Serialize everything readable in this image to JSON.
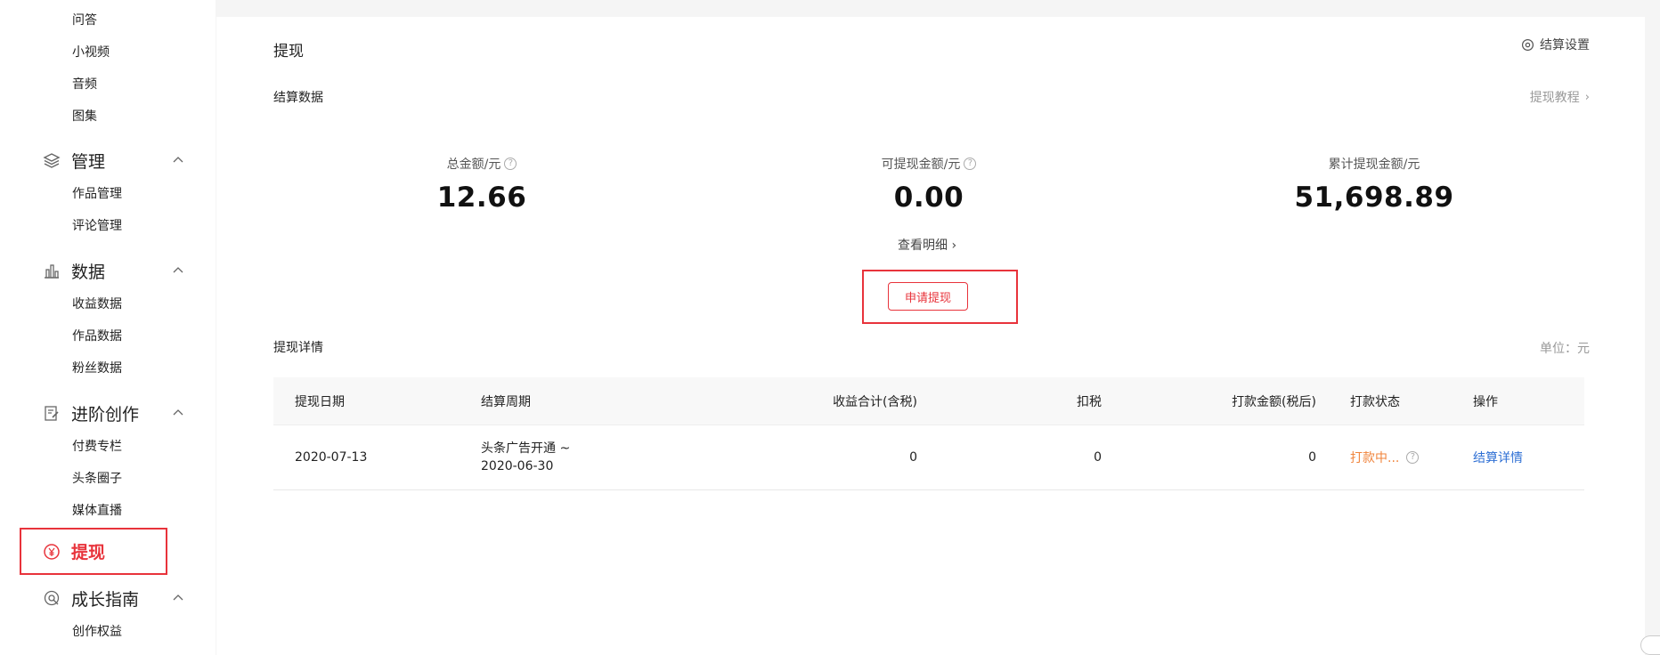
{
  "sidebar": {
    "top_items": [
      "问答",
      "小视频",
      "音频",
      "图集"
    ],
    "groups": [
      {
        "label": "管理",
        "icon": "layers-icon",
        "items": [
          "作品管理",
          "评论管理"
        ]
      },
      {
        "label": "数据",
        "icon": "bar-chart-icon",
        "items": [
          "收益数据",
          "作品数据",
          "粉丝数据"
        ]
      },
      {
        "label": "进阶创作",
        "icon": "edit-doc-icon",
        "items": [
          "付费专栏",
          "头条圈子",
          "媒体直播"
        ]
      }
    ],
    "active": {
      "label": "提现",
      "icon": "yen-circle-icon"
    },
    "growth": {
      "label": "成长指南",
      "icon": "growth-icon",
      "items": [
        "创作权益"
      ]
    }
  },
  "main": {
    "title": "提现",
    "settings_label": "结算设置",
    "section_settlement": "结算数据",
    "tutorial_label": "提现教程",
    "stats": [
      {
        "label": "总金额/元",
        "value": "12.66",
        "help": true
      },
      {
        "label": "可提现金额/元",
        "value": "0.00",
        "help": true
      },
      {
        "label": "累计提现金额/元",
        "value": "51,698.89",
        "help": false
      }
    ],
    "detail_link": "查看明细",
    "apply_button": "申请提现",
    "section_detail": "提现详情",
    "unit": "单位：元"
  },
  "table": {
    "headers": [
      "提现日期",
      "结算周期",
      "收益合计(含税)",
      "扣税",
      "打款金额(税后)",
      "打款状态",
      "操作"
    ],
    "rows": [
      {
        "date": "2020-07-13",
        "period_line1": "头条广告开通 ~",
        "period_line2": "2020-06-30",
        "income": "0",
        "tax": "0",
        "paid": "0",
        "status": "打款中...",
        "action": "结算详情"
      }
    ]
  },
  "colors": {
    "accent_red": "#e8333b",
    "status_orange": "#f0843c",
    "link_blue": "#2e6fd4"
  }
}
